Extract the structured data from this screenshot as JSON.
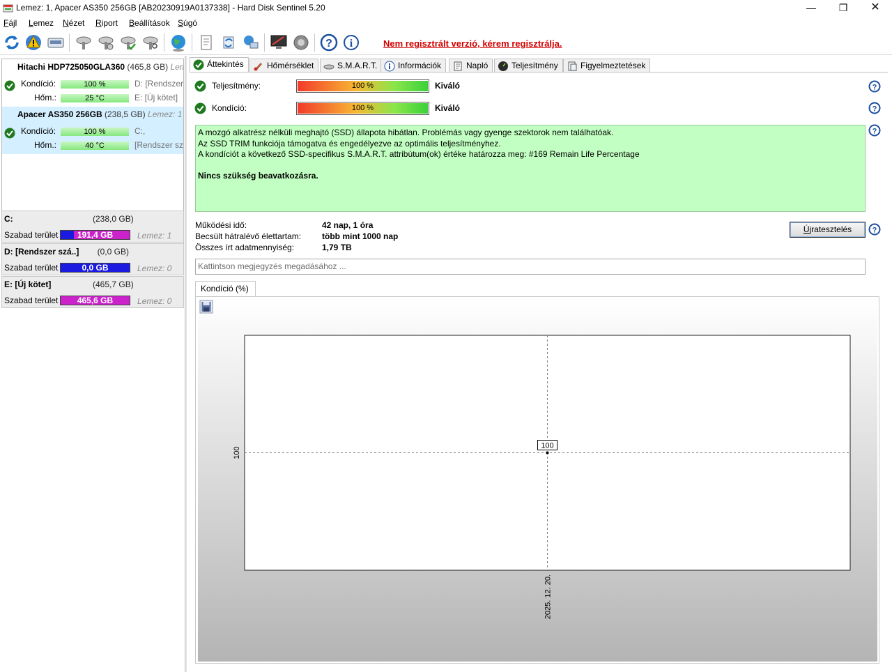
{
  "window": {
    "title": "Lemez: 1, Apacer AS350 256GB [AB20230919A0137338]  -  Hard Disk Sentinel 5.20",
    "minimize_glyph": "—",
    "maximize_glyph": "❐",
    "close_glyph": "✕"
  },
  "menu": [
    "Fájl",
    "Lemez",
    "Nézet",
    "Riport",
    "Beállítások",
    "Súgó"
  ],
  "toolbar": {
    "icons": [
      "refresh-icon",
      "alert-icon",
      "disk-info-icon",
      "disk-settings-icon",
      "disk-test-icon",
      "disk-check-icon",
      "disk-search-icon",
      "globe-icon",
      "report-icon",
      "sync-icon",
      "network-icon",
      "monitor-icon",
      "speaker-icon",
      "help-icon",
      "info-icon"
    ],
    "registration_text": "Nem regisztrált verzió, kérem regisztrálja."
  },
  "disks": [
    {
      "name": "Hitachi HDP725050GLA360",
      "size": "(465,8 GB)",
      "extra": "Leme",
      "condition_label": "Kondíció:",
      "condition_value": "100 %",
      "condition_pct": 100,
      "temp_label": "Hőm.:",
      "temp_value": "25 °C",
      "volumes_line1": "D: [Rendszer s",
      "volumes_line2": "E: [Új kötet]",
      "selected": false
    },
    {
      "name": "Apacer AS350 256GB",
      "size": "(238,5 GB)",
      "extra": "Lemez: 1",
      "condition_label": "Kondíció:",
      "condition_value": "100 %",
      "condition_pct": 100,
      "temp_label": "Hőm.:",
      "temp_value": "40 °C",
      "volumes_line1": "C:,",
      "volumes_line2": "[Rendszer szá",
      "selected": true
    }
  ],
  "volumes": [
    {
      "name": "C:",
      "size": "(238,0 GB)",
      "free_label": "Szabad terület",
      "free": "191,4 GB",
      "used_fraction": 0.196,
      "disk": "Lemez: 1"
    },
    {
      "name": "D: [Rendszer szá..]",
      "size": "(0,0 GB)",
      "free_label": "Szabad terület",
      "free": "0,0 GB",
      "used_fraction": 1.0,
      "disk": "Lemez: 0"
    },
    {
      "name": "E: [Új kötet]",
      "size": "(465,7 GB)",
      "free_label": "Szabad terület",
      "free": "465,6 GB",
      "used_fraction": 0.0,
      "disk": "Lemez: 0"
    }
  ],
  "tabs": [
    {
      "label": "Áttekintés",
      "icon": "check-icon",
      "active": true
    },
    {
      "label": "Hőmérséklet",
      "icon": "thermometer-icon",
      "active": false
    },
    {
      "label": "S.M.A.R.T.",
      "icon": "smart-icon",
      "active": false
    },
    {
      "label": "Információk",
      "icon": "info-icon",
      "active": false
    },
    {
      "label": "Napló",
      "icon": "log-icon",
      "active": false
    },
    {
      "label": "Teljesítmény",
      "icon": "performance-icon",
      "active": false
    },
    {
      "label": "Figyelmeztetések",
      "icon": "warnings-icon",
      "active": false
    }
  ],
  "overview": {
    "performance": {
      "label": "Teljesítmény:",
      "value_text": "100 %",
      "pct": 100,
      "rating": "Kiváló"
    },
    "health": {
      "label": "Kondíció:",
      "value_text": "100 %",
      "pct": 100,
      "rating": "Kiváló"
    },
    "description": [
      "A mozgó alkatrész nélküli meghajtó (SSD) állapota hibátlan. Problémás vagy gyenge szektorok nem találhatóak.",
      "Az SSD TRIM funkciója támogatva és engedélyezve az optimális teljesítményhez.",
      "A kondíciót a következő SSD-specifikus S.M.A.R.T. attribútum(ok) értéke határozza meg:  #169 Remain Life Percentage"
    ],
    "action": "Nincs szükség beavatkozásra.",
    "uptime": {
      "label": "Működési idő:",
      "value": "42 nap, 1 óra"
    },
    "lifetime": {
      "label": "Becsült hátralévő élettartam:",
      "value": "több mint 1000 nap"
    },
    "written": {
      "label": "Összes írt adatmennyiség:",
      "value": "1,79 TB"
    },
    "retest_button": "Újratesztelés",
    "note_placeholder": "Kattintson megjegyzés megadásához ..."
  },
  "chart_tab_label": "Kondíció  (%)",
  "chart_data": {
    "type": "line",
    "x": [
      "2025. 12. 20."
    ],
    "series": [
      {
        "values": [
          100
        ]
      }
    ],
    "point_labels": [
      "100"
    ],
    "y_ticks": [
      "100"
    ],
    "x_ticks": [
      "2025. 12. 20."
    ],
    "grid": true,
    "colors": {
      "background_top": "#ffffff",
      "background_bottom": "#b4b4b4",
      "plot": "#ffffff",
      "grid": "#808080"
    }
  },
  "colors": {
    "accent_green": "#c2ffc2",
    "health_bar": "#86e77f",
    "link_red": "#d40000",
    "selected_disk": "#d4efff"
  }
}
